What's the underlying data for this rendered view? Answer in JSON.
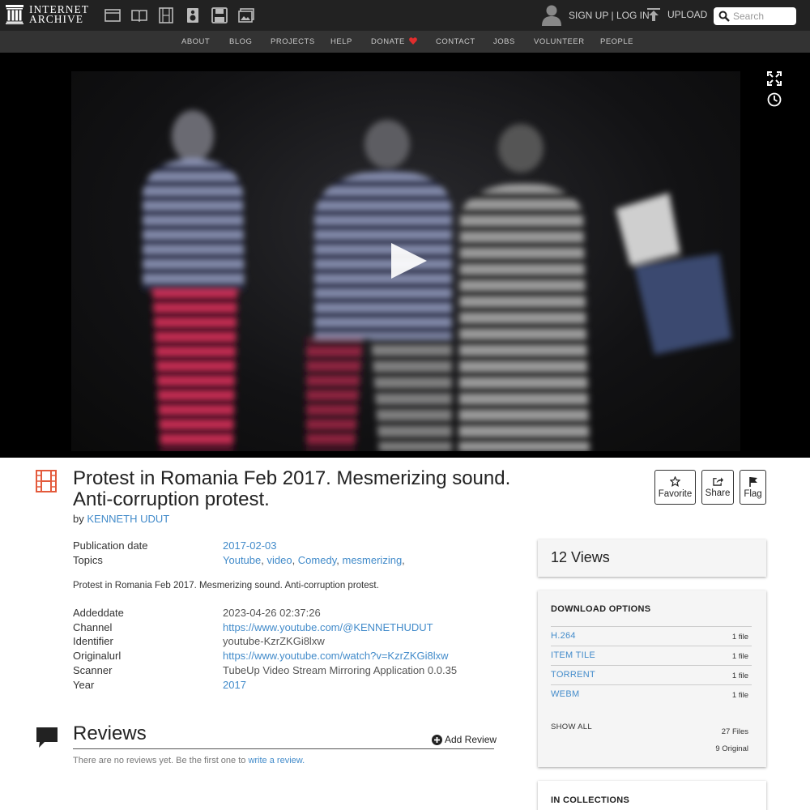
{
  "brand": {
    "line1": "INTERNET",
    "line2": "ARCHIVE"
  },
  "media_types": [
    {
      "icon": "web-icon"
    },
    {
      "icon": "texts-icon"
    },
    {
      "icon": "video-icon"
    },
    {
      "icon": "audio-icon"
    },
    {
      "icon": "software-icon"
    },
    {
      "icon": "images-icon"
    }
  ],
  "account": {
    "signup": "SIGN UP",
    "separator": "|",
    "login": "LOG IN"
  },
  "upload": {
    "label": "UPLOAD"
  },
  "search": {
    "placeholder": "Search"
  },
  "nav": {
    "about": "ABOUT",
    "blog": "BLOG",
    "projects": "PROJECTS",
    "help": "HELP",
    "donate": "DONATE",
    "contact": "CONTACT",
    "jobs": "JOBS",
    "volunteer": "VOLUNTEER",
    "people": "PEOPLE"
  },
  "colors": {
    "accent": "#428bca",
    "donate_heart": "#e02d2d",
    "film_icon": "#e35a3c"
  },
  "item": {
    "title": "Protest in Romania Feb 2017. Mesmerizing sound. Anti-corruption protest.",
    "by_prefix": "by",
    "creator": "KENNETH UDUT",
    "actions": {
      "favorite": "Favorite",
      "share": "Share",
      "flag": "Flag"
    }
  },
  "metadata": {
    "publication_date": {
      "key": "Publication date",
      "value": "2017-02-03"
    },
    "topics": {
      "key": "Topics",
      "items": [
        "Youtube",
        "video",
        "Comedy",
        "mesmerizing"
      ],
      "sep": ", ",
      "trail": ","
    },
    "description": "Protest in Romania Feb 2017. Mesmerizing sound. Anti-corruption protest.",
    "addeddate": {
      "key": "Addeddate",
      "value": "2023-04-26 02:37:26"
    },
    "channel": {
      "key": "Channel",
      "value": "https://www.youtube.com/@KENNETHUDUT"
    },
    "identifier": {
      "key": "Identifier",
      "value": "youtube-KzrZKGi8lxw"
    },
    "originalurl": {
      "key": "Originalurl",
      "value": "https://www.youtube.com/watch?v=KzrZKGi8lxw"
    },
    "scanner": {
      "key": "Scanner",
      "value": "TubeUp Video Stream Mirroring Application 0.0.35"
    },
    "year": {
      "key": "Year",
      "value": "2017"
    }
  },
  "reviews": {
    "title": "Reviews",
    "add_label": "Add Review",
    "empty_text": "There are no reviews yet. Be the first one to ",
    "write_link": "write a review."
  },
  "sidebar": {
    "views": "12 Views",
    "download": {
      "title": "DOWNLOAD OPTIONS",
      "options": [
        {
          "format": "H.264",
          "count": "1 file"
        },
        {
          "format": "ITEM TILE",
          "count": "1 file"
        },
        {
          "format": "TORRENT",
          "count": "1 file"
        },
        {
          "format": "WEBM",
          "count": "1 file"
        }
      ],
      "show_all": "SHOW ALL",
      "total_files": "27 Files",
      "original_files": "9 Original"
    },
    "collections_title": "IN COLLECTIONS"
  }
}
